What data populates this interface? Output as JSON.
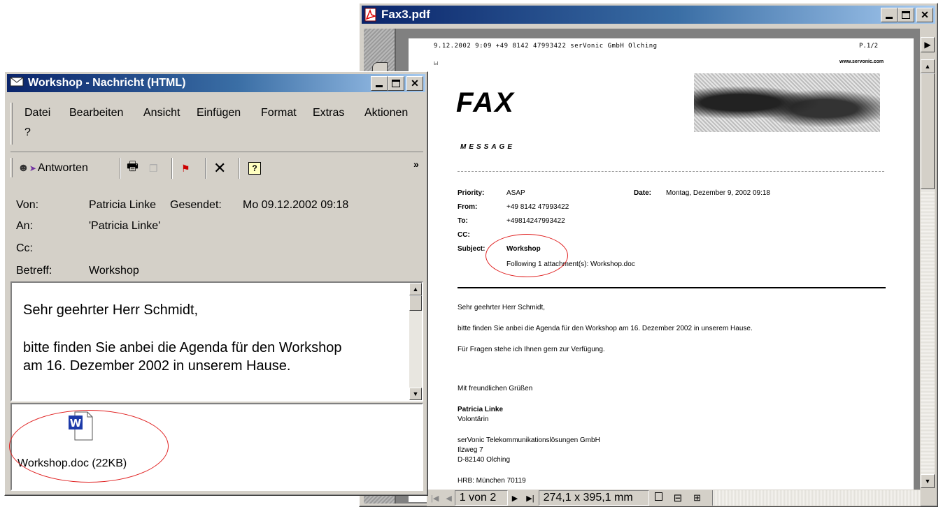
{
  "outlook": {
    "title": "Workshop - Nachricht (HTML)",
    "menu": [
      {
        "label": "Datei"
      },
      {
        "label": "Bearbeiten"
      },
      {
        "label": "Ansicht"
      },
      {
        "label": "Einfügen"
      },
      {
        "label": "Format"
      },
      {
        "label": "Extras"
      },
      {
        "label": "Aktionen"
      },
      {
        "label": "?"
      }
    ],
    "toolbar": {
      "reply_label": "Antworten",
      "overflow": "»"
    },
    "headers": {
      "from_label": "Von:",
      "from_value": "Patricia Linke",
      "sent_label": "Gesendet:",
      "sent_value": "Mo 09.12.2002 09:18",
      "to_label": "An:",
      "to_value": "'Patricia Linke'",
      "cc_label": "Cc:",
      "cc_value": "",
      "subject_label": "Betreff:",
      "subject_value": "Workshop"
    },
    "body": {
      "greeting": "Sehr geehrter Herr Schmidt,",
      "line1": "bitte finden Sie anbei die Agenda für den Workshop",
      "line2": "am 16. Dezember 2002 in unserem Hause."
    },
    "attachment": {
      "filename": "Workshop.doc (22KB)",
      "icon": "word-document-icon"
    }
  },
  "pdf": {
    "title": "Fax3.pdf",
    "header_line": "9.12.2002  9:09  +49 8142 47993422  serVonic GmbH Olching",
    "page_marker": "P.1/2",
    "website": "www.servonic.com",
    "fax_title": "FAX",
    "fax_subtitle": "MESSAGE",
    "fields": {
      "priority_label": "Priority:",
      "priority_value": "ASAP",
      "date_label": "Date:",
      "date_value": "Montag, Dezember 9, 2002 09:18",
      "from_label": "From:",
      "from_value": "+49 8142 47993422",
      "to_label": "To:",
      "to_value": "+49814247993422",
      "cc_label": "CC:",
      "subject_label": "Subject:",
      "subject_value": "Workshop",
      "attachment_note": "Following 1 attachment(s): Workshop.doc"
    },
    "body": {
      "greeting": "Sehr geehrter Herr Schmidt,",
      "line1": "bitte finden Sie anbei die Agenda für den Workshop am 16. Dezember 2002 in unserem Hause.",
      "line2": "Für Fragen stehe ich Ihnen gern zur Verfügung.",
      "closing": "Mit freundlichen Grüßen",
      "sender_name": "Patricia Linke",
      "sender_role": "Volontärin",
      "company": "serVonic Telekommunikationslösungen GmbH",
      "street": "Ilzweg 7",
      "city": "D-82140 Olching",
      "registry": "HRB: München 70119"
    },
    "status": {
      "page": "1 von 2",
      "size": "274,1 x 395,1 mm"
    }
  },
  "colors": {
    "titlebar_start": "#0a246a",
    "titlebar_end": "#a6caf0",
    "annotation_red": "#e02020",
    "window_face": "#d4d0c8"
  }
}
